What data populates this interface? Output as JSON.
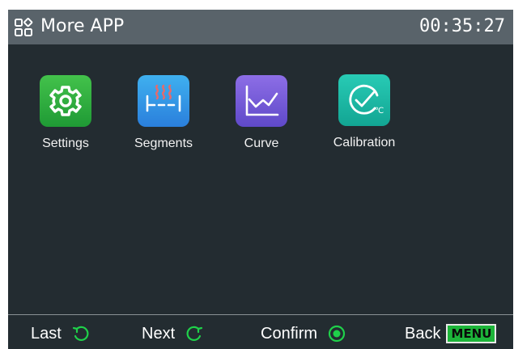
{
  "header": {
    "icon": "apps-grid-icon",
    "title": "More APP",
    "time": "00:35:27"
  },
  "apps": [
    {
      "label": "Settings",
      "icon": "gear-icon",
      "color": "#2fae3d"
    },
    {
      "label": "Segments",
      "icon": "heating-segments-icon",
      "color": "#2d8fe5"
    },
    {
      "label": "Curve",
      "icon": "line-chart-icon",
      "color": "#7a5bd6"
    },
    {
      "label": "Calibration",
      "icon": "temperature-calibration-icon",
      "color": "#18b9a6"
    }
  ],
  "footer": {
    "last_label": "Last",
    "last_icon": "rotate-left-icon",
    "next_label": "Next",
    "next_icon": "rotate-right-icon",
    "confirm_label": "Confirm",
    "confirm_icon": "press-button-icon",
    "back_label": "Back",
    "back_key": "MENU"
  },
  "colors": {
    "background": "#232c31",
    "header": "#59636a",
    "accent_green": "#1db53a"
  }
}
